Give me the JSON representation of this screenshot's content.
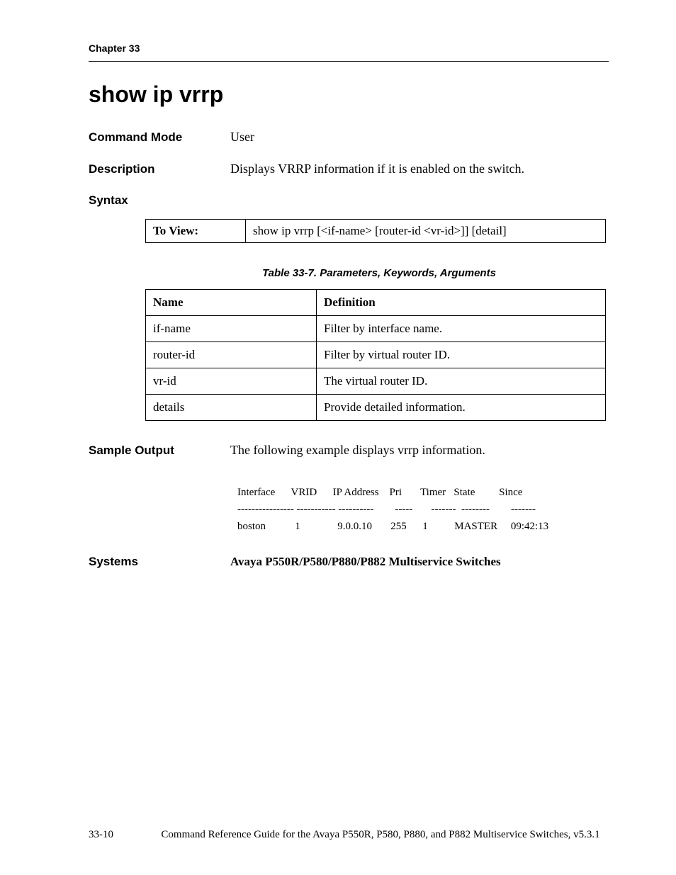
{
  "chapter": "Chapter 33",
  "title": "show ip vrrp",
  "sections": {
    "command_mode_label": "Command Mode",
    "command_mode_value": "User",
    "description_label": "Description",
    "description_value": "Displays VRRP information if it is enabled on the switch.",
    "syntax_label": "Syntax",
    "syntax_row_label": "To View:",
    "syntax_row_value": "show ip vrrp [<if-name> [router-id <vr-id>]] [detail]",
    "table_caption": "Table 33-7.  Parameters, Keywords, Arguments",
    "param_headers": {
      "name": "Name",
      "definition": "Definition"
    },
    "params": [
      {
        "name": "if-name",
        "def": "Filter by interface name."
      },
      {
        "name": "router-id",
        "def": "Filter by virtual router ID."
      },
      {
        "name": "vr-id",
        "def": "The virtual router ID."
      },
      {
        "name": "details",
        "def": "Provide detailed information."
      }
    ],
    "sample_output_label": "Sample Output",
    "sample_output_intro": "The following example displays vrrp information.",
    "sample_output_lines": [
      "Interface      VRID      IP Address    Pri       Timer   State         Since",
      "---------------- ----------- ----------        -----       -------  --------        -------",
      "boston           1              9.0.0.10       255      1          MASTER     09:42:13"
    ],
    "systems_label": "Systems",
    "systems_value": "Avaya P550R/P580/P880/P882 Multiservice Switches"
  },
  "footer": {
    "page_num": "33-10",
    "text": "Command Reference Guide for the Avaya P550R, P580, P880, and P882 Multiservice Switches, v5.3.1"
  }
}
